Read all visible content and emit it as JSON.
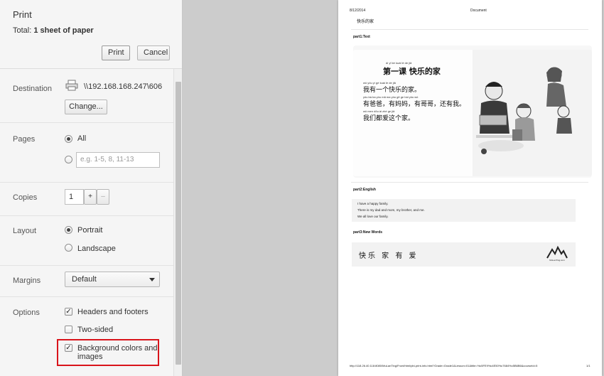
{
  "header": {
    "title": "Print",
    "total_label": "Total:",
    "total_value": "1 sheet of paper",
    "print_label": "Print",
    "cancel_label": "Cancel"
  },
  "destination": {
    "label": "Destination",
    "printer": "\\\\192.168.168.247\\606",
    "change_label": "Change..."
  },
  "pages": {
    "label": "Pages",
    "all_label": "All",
    "custom_placeholder": "e.g. 1-5, 8, 11-13"
  },
  "copies": {
    "label": "Copies",
    "value": "1",
    "plus": "+",
    "minus": "–"
  },
  "layout": {
    "label": "Layout",
    "portrait_label": "Portrait",
    "landscape_label": "Landscape"
  },
  "margins": {
    "label": "Margins",
    "value": "Default"
  },
  "options": {
    "label": "Options",
    "headers_footers": "Headers and footers",
    "two_sided": "Two-sided",
    "background": "Background colors and",
    "background_2": "images"
  },
  "preview": {
    "date": "8/12/2014",
    "doc_label": "Document",
    "page_heading": "快乐的家",
    "part1": "part1:Text",
    "lesson_pinyin": "dì   yī   kè      kuài  lè   de   jiā",
    "lesson_title": "第一课   快乐的家",
    "line1_py": "wǒ yǒu  yí   gè  kuài  lè   de  jiā",
    "line1": "我有一个快乐的家。",
    "line2_py": "yǒu bà  ba    yǒu mā  ma    yǒu gē  ge    hái  yǒu  wǒ",
    "line2": "有爸爸，有妈妈，有哥哥，还有我。",
    "line3_py": "wǒ men dōu  ài   zhè  ge  jiā",
    "line3": "我们都爱这个家。",
    "part2": "part2:English",
    "eng1": "I have a happy family.",
    "eng2": "There is my dad and mom, my brother, and me.",
    "eng3": "We all love our family.",
    "part3": "part3:New Words",
    "new_words": "快乐  家  有  爱",
    "logo_text": "MuLanTing.com",
    "footer_url": "http://118.26.40.118:8080/MuLanTing/Front/html/pbl-print-info.html?Grade=Grade1&Lesson=01&title=%c5FE9%c4E50%c7684%c5B6B6&courseId=5",
    "page_num": "1/1"
  }
}
